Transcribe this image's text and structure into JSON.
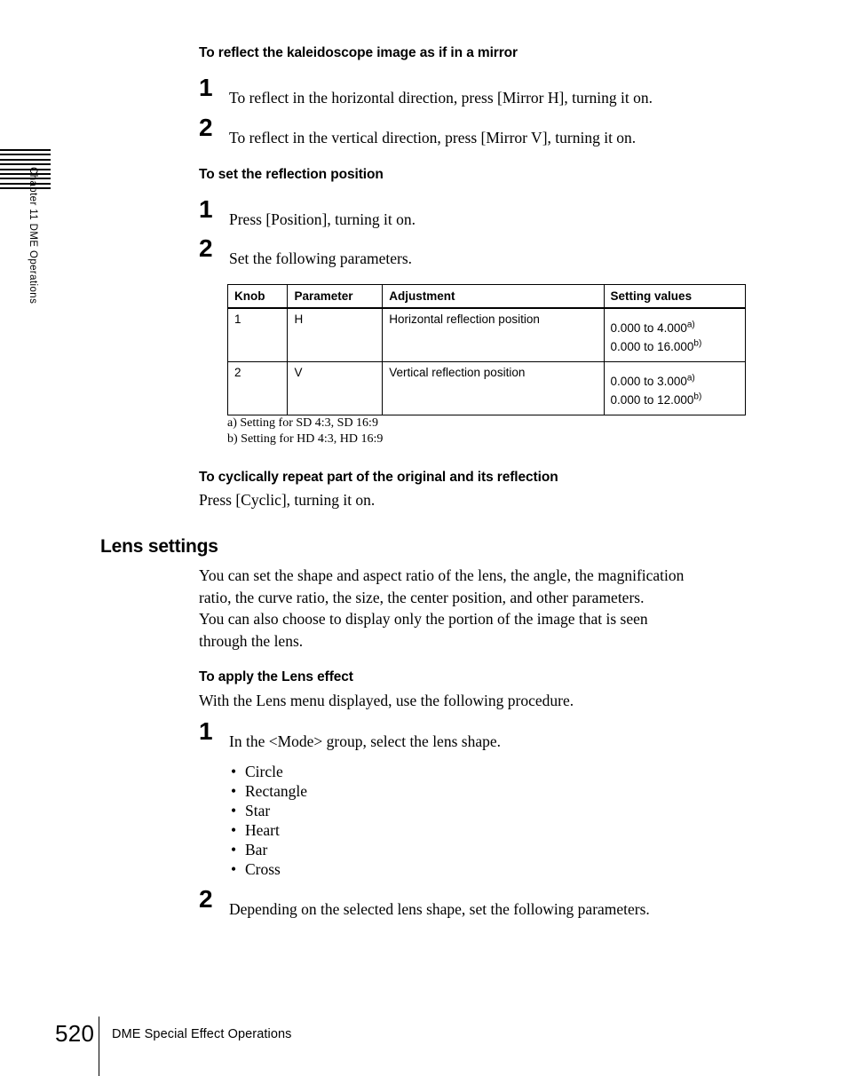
{
  "sidebar": {
    "chapter_label": "Chapter 11   DME Operations",
    "tab_mark_count": 9
  },
  "sections": {
    "mirror": {
      "heading": "To reflect the kaleidoscope image as if in a mirror",
      "steps": [
        {
          "number": "1",
          "text": "To reflect in the horizontal direction, press [Mirror H], turning it on."
        },
        {
          "number": "2",
          "text": "To reflect in the vertical direction, press [Mirror V], turning it on."
        }
      ]
    },
    "reflection_position": {
      "heading": "To set the reflection position",
      "steps": [
        {
          "number": "1",
          "text": "Press [Position], turning it on."
        },
        {
          "number": "2",
          "text": "Set the following parameters."
        }
      ]
    },
    "cyclic": {
      "heading": "To cyclically repeat part of the original and its reflection",
      "body": "Press [Cyclic], turning it on."
    },
    "lens_settings": {
      "heading": "Lens settings",
      "body_line_1": "You can set the shape and aspect ratio of the lens, the angle, the magnification",
      "body_line_2": "ratio, the curve ratio, the size, the center position, and other parameters.",
      "body_line_3": "You can also choose to display only the portion of the image that is seen",
      "body_line_4": "through the lens."
    },
    "apply_lens": {
      "heading": "To apply the Lens effect",
      "intro": "With the Lens menu displayed, use the following procedure.",
      "step_1": {
        "number": "1",
        "text": "In the <Mode> group, select the lens shape."
      },
      "shapes": [
        "Circle",
        "Rectangle",
        "Star",
        "Heart",
        "Bar",
        "Cross"
      ],
      "bullet_glyph": "•",
      "step_2": {
        "number": "2",
        "text": "Depending on the selected lens shape, set the following parameters."
      }
    }
  },
  "table": {
    "headers": [
      "Knob",
      "Parameter",
      "Adjustment",
      "Setting values"
    ],
    "rows": [
      {
        "knob": "1",
        "parameter": "H",
        "adjustment": "Horizontal reflection position",
        "setting_line_1": "0.000 to 4.000",
        "setting_note_1": "a)",
        "setting_line_2": "0.000 to 16.000",
        "setting_note_2": "b)"
      },
      {
        "knob": "2",
        "parameter": "V",
        "adjustment": "Vertical reflection position",
        "setting_line_1": "0.000 to 3.000",
        "setting_note_1": "a)",
        "setting_line_2": "0.000 to 12.000",
        "setting_note_2": "b)"
      }
    ],
    "footnotes": {
      "a": "a) Setting for SD 4:3, SD 16:9",
      "b": "b) Setting for HD 4:3, HD 16:9"
    }
  },
  "footer": {
    "page_number": "520",
    "section_title": "DME Special Effect Operations"
  }
}
